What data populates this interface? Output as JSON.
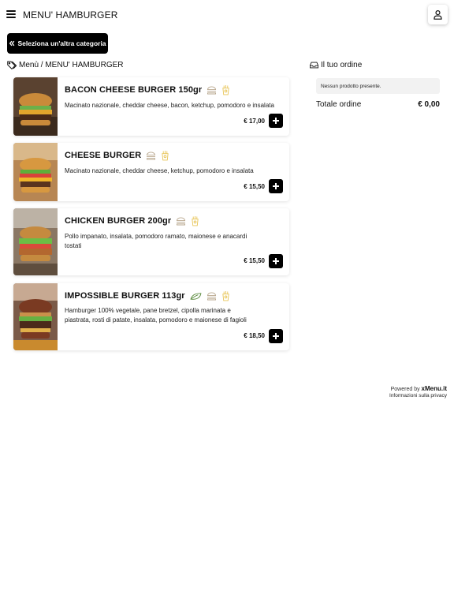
{
  "header": {
    "title": "MENU' HAMBURGER"
  },
  "back_button": {
    "label": "Seleziona un'altra categoria"
  },
  "breadcrumb": {
    "text": "Menù / MENU' HAMBURGER"
  },
  "order": {
    "title": "Il tuo ordine",
    "empty_text": "Nessun prodotto presente.",
    "total_label": "Totale ordine",
    "total_value": "€ 0,00"
  },
  "products": [
    {
      "name": "BACON CHEESE BURGER 150gr",
      "description": "Macinato nazionale, cheddar cheese, bacon, ketchup, pomodoro e insalata",
      "price": "€ 17,00",
      "badges": [
        "burger-icon",
        "fries-icon"
      ]
    },
    {
      "name": "CHEESE BURGER",
      "description": "Macinato nazionale, cheddar cheese, ketchup, pomodoro e insalata",
      "price": "€ 15,50",
      "badges": [
        "burger-icon",
        "fries-icon"
      ]
    },
    {
      "name": "CHICKEN BURGER 200gr",
      "description": "Pollo impanato, insalata, pomodoro ramato, maionese e anacardi tostati",
      "price": "€ 15,50",
      "badges": [
        "burger-icon",
        "fries-icon"
      ]
    },
    {
      "name": "IMPOSSIBLE BURGER 113gr",
      "description": "Hamburger 100% vegetale, pane bretzel, cipolla marinata e piastrata, rosti di patate, insalata, pomodoro e maionese di fagioli",
      "price": "€ 18,50",
      "badges": [
        "leaf-icon",
        "burger-icon",
        "fries-icon"
      ]
    }
  ],
  "footer": {
    "powered_prefix": "Powered by",
    "powered_brand": "xMenu.it",
    "privacy": "Informazioni sulla privacy"
  },
  "colors": {
    "accent": "#000000",
    "badge_burger": "#b9a88f",
    "badge_fries": "#e8c65a",
    "badge_leaf": "#5a8a3c"
  }
}
